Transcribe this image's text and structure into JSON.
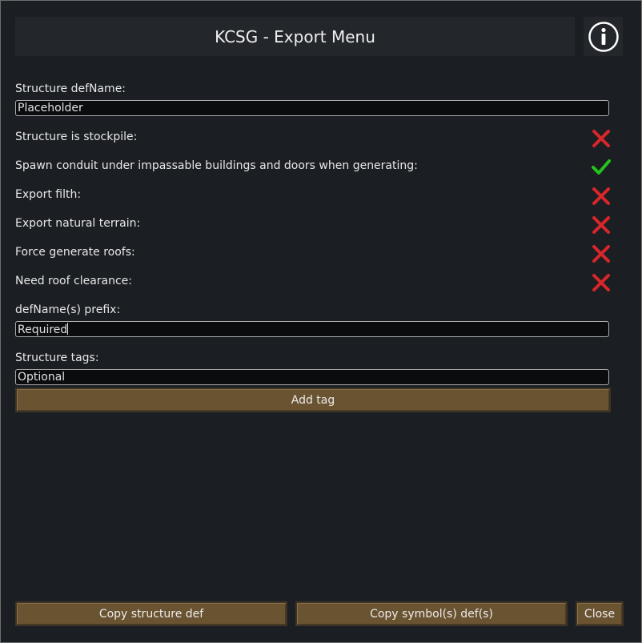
{
  "window": {
    "title": "KCSG - Export Menu",
    "info_icon": "info-circle-icon"
  },
  "fields": {
    "structure_defname_label": "Structure defName:",
    "structure_defname_value": "Placeholder",
    "defname_prefix_label": "defName(s) prefix:",
    "defname_prefix_value": "Required",
    "structure_tags_label": "Structure tags:",
    "structure_tags_value": "Optional"
  },
  "toggles": [
    {
      "label": "Structure is stockpile:",
      "checked": false
    },
    {
      "label": "Spawn conduit under impassable buildings and doors when generating:",
      "checked": true
    },
    {
      "label": "Export filth:",
      "checked": false
    },
    {
      "label": "Export natural terrain:",
      "checked": false
    },
    {
      "label": "Force generate roofs:",
      "checked": false
    },
    {
      "label": "Need roof clearance:",
      "checked": false
    }
  ],
  "colors": {
    "check": "#22c41c",
    "cross": "#d8262a",
    "button": "#6a5331"
  },
  "buttons": {
    "add_tag": "Add tag",
    "copy_structure_def": "Copy structure def",
    "copy_symbol_defs": "Copy symbol(s) def(s)",
    "close": "Close"
  }
}
